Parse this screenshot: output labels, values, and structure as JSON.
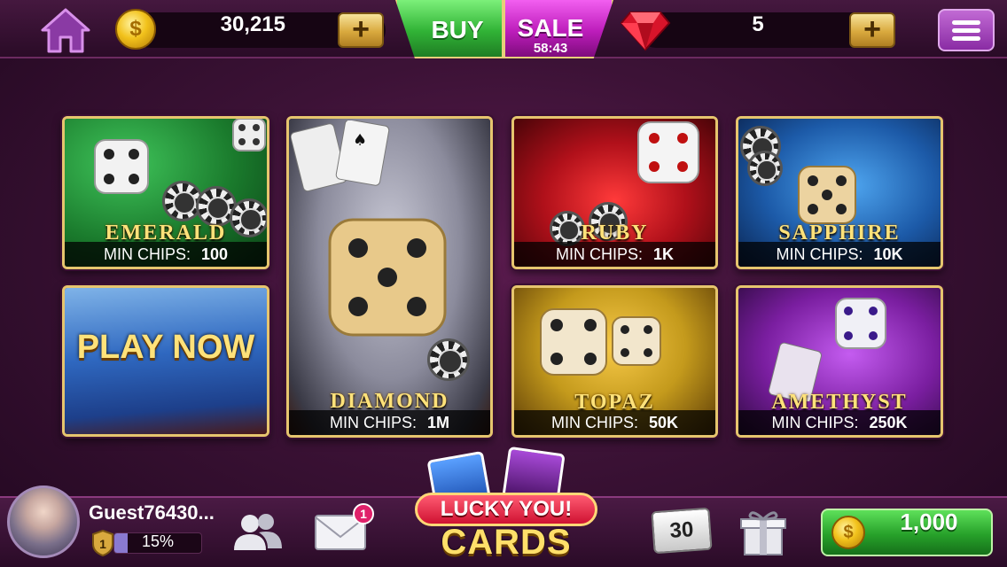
{
  "top_bar": {
    "coins": "30,215",
    "coin_symbol": "$",
    "buy_label": "BUY",
    "sale_label": "SALE",
    "sale_timer": "58:43",
    "gems": "5",
    "plus_label": "+"
  },
  "tables": [
    {
      "name": "EMERALD",
      "min_label": "MIN CHIPS:",
      "min_value": "100",
      "color": "#1f8a2e"
    },
    {
      "name": "DIAMOND",
      "min_label": "MIN CHIPS:",
      "min_value": "1M",
      "color": "#8c8c9a"
    },
    {
      "name": "RUBY",
      "min_label": "MIN CHIPS:",
      "min_value": "1K",
      "color": "#b0101a"
    },
    {
      "name": "SAPPHIRE",
      "min_label": "MIN CHIPS:",
      "min_value": "10K",
      "color": "#1c5aa8"
    },
    {
      "name": "TOPAZ",
      "min_label": "MIN CHIPS:",
      "min_value": "50K",
      "color": "#c49a1c"
    },
    {
      "name": "AMETHYST",
      "min_label": "MIN CHIPS:",
      "min_value": "250K",
      "color": "#7a1ea0"
    }
  ],
  "play_now": {
    "label": "PLAY NOW"
  },
  "bottom_bar": {
    "player_name": "Guest76430...",
    "level": "1",
    "level_progress_pct": "15%",
    "level_progress": 0.15,
    "mail_badge": "1",
    "lucky_top": "LUCKY YOU!",
    "lucky_bottom": "CARDS",
    "calendar_day": "30",
    "collect_amount": "1,000",
    "coin_symbol": "$"
  },
  "colors": {
    "background": "#3c1236",
    "gold_border": "#e6c56e",
    "buy_green": "#31b336",
    "sale_magenta": "#bd1dbb"
  }
}
